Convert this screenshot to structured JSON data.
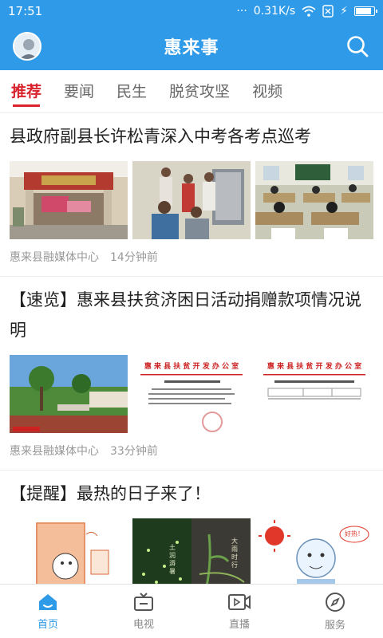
{
  "status_bar": {
    "time": "17:51",
    "network_speed": "0.31K/s"
  },
  "app": {
    "title": "惠来事"
  },
  "tabs": [
    {
      "label": "推荐",
      "active": true
    },
    {
      "label": "要闻",
      "active": false
    },
    {
      "label": "民生",
      "active": false
    },
    {
      "label": "脱贫攻坚",
      "active": false
    },
    {
      "label": "视频",
      "active": false
    }
  ],
  "articles": [
    {
      "headline": "县政府副县长许松青深入中考各考点巡考",
      "source": "惠来县融媒体中心",
      "time": "14分钟前"
    },
    {
      "headline": "【速览】惠来县扶贫济困日活动捐赠款项情况说明",
      "source": "惠来县融媒体中心",
      "time": "33分钟前",
      "doc_header_1": "惠 来 县 扶 贫 开 发 办 公 室",
      "doc_header_2": "惠 来 县 扶 贫 开 发 办 公 室"
    },
    {
      "headline": "【提醒】最热的日子来了！",
      "poster_labels": [
        "土润溽暑",
        "大雨时行"
      ],
      "cartoon_text": "好热！"
    }
  ],
  "bottom_nav": [
    {
      "label": "首页",
      "icon": "home-icon",
      "active": true
    },
    {
      "label": "电视",
      "icon": "tv-icon",
      "active": false
    },
    {
      "label": "直播",
      "icon": "live-video-icon",
      "active": false
    },
    {
      "label": "服务",
      "icon": "compass-icon",
      "active": false
    }
  ],
  "colors": {
    "primary": "#2f9be8",
    "tab_active": "#d9232d"
  }
}
